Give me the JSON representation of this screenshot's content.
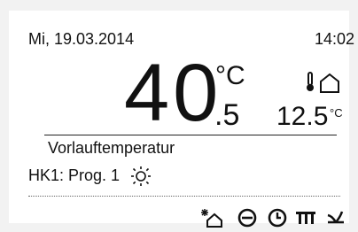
{
  "header": {
    "date": "Mi, 19.03.2014",
    "time": "14:02"
  },
  "main": {
    "temperature_integer": "40",
    "temperature_decimal": ".5",
    "temperature_unit": "°C",
    "outdoor_temperature": "12.5",
    "outdoor_unit": "°C",
    "label": "Vorlauftemperatur",
    "program": "HK1: Prog. 1"
  },
  "icons": {
    "outdoor": "thermometer-house-icon",
    "program_mode": "sun-icon",
    "bottom": [
      "holiday-snow-house-icon",
      "heating-mode-icon",
      "clock-icon",
      "radiator-icon",
      "fan-icon"
    ]
  }
}
